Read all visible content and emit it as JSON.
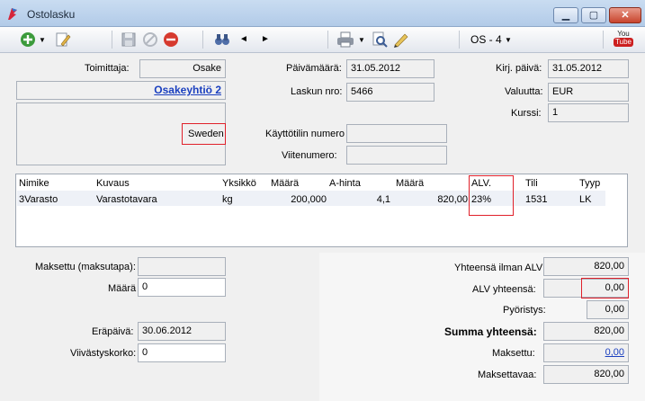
{
  "window": {
    "title": "Ostolasku",
    "min_glyph": "▁",
    "max_glyph": "▢",
    "close_glyph": "✕"
  },
  "toolbar": {
    "icons": [
      "add-icon",
      "dropdown-arrow-icon",
      "edit-icon",
      "save-icon",
      "cancel-icon",
      "delete-icon",
      "binoculars-icon",
      "prev-arrow-icon",
      "next-arrow-icon",
      "print-icon",
      "dropdown-arrow-icon",
      "preview-icon",
      "sign-icon",
      "youtube-icon"
    ],
    "prev_glyph": "◄",
    "next_glyph": "►",
    "dropdown_glyph": "▼",
    "os_label": "OS - 4",
    "youtube_you": "You",
    "youtube_tube": "Tube"
  },
  "header": {
    "supplier_label": "Toimittaja:",
    "supplier_code": "Osake",
    "supplier_name": "Osakeyhtiö 2",
    "supplier_country": "Sweden",
    "date_label": "Päivämäärä:",
    "date_value": "31.05.2012",
    "invoice_no_label": "Laskun nro:",
    "invoice_no_value": "5466",
    "account_no_label": "Käyttötilin numero",
    "account_no_value": "",
    "reference_label": "Viitenumero:",
    "reference_value": "",
    "booking_date_label": "Kirj. päivä:",
    "booking_date_value": "31.05.2012",
    "currency_label": "Valuutta:",
    "currency_value": "EUR",
    "rate_label": "Kurssi:",
    "rate_value": "1"
  },
  "grid": {
    "columns": [
      "Nimike",
      "Kuvaus",
      "Yksikkö",
      "Määrä",
      "A-hinta",
      "Määrä",
      "ALV.",
      "Tili",
      "Tyyp"
    ],
    "rows": [
      [
        "3Varasto",
        "Varastotavara",
        "kg",
        "200,000",
        "4,1",
        "820,00",
        "23%",
        "1531",
        "LK"
      ]
    ]
  },
  "footer": {
    "paid_method_label": "Maksettu (maksutapa):",
    "paid_method_value": "",
    "amount_label": "Määrä",
    "amount_value": "0",
    "due_date_label": "Eräpäivä:",
    "due_date_value": "30.06.2012",
    "late_interest_label": "Viivästyskorko:",
    "late_interest_value": "0",
    "total_excl_vat_label": "Yhteensä ilman ALV",
    "total_excl_vat_value": "820,00",
    "vat_total_label": "ALV yhteensä:",
    "vat_total_value": "0,00",
    "rounding_label": "Pyöristys:",
    "rounding_value": "0,00",
    "grand_total_label": "Summa yhteensä:",
    "grand_total_value": "820,00",
    "paid_label": "Maksettu:",
    "paid_value": "0,00",
    "payable_label": "Maksettavaa:",
    "payable_value": "820,00"
  },
  "colors": {
    "highlight": "#e0202a",
    "link": "#1a3fbf",
    "titlebar": "#b9d0ec"
  }
}
